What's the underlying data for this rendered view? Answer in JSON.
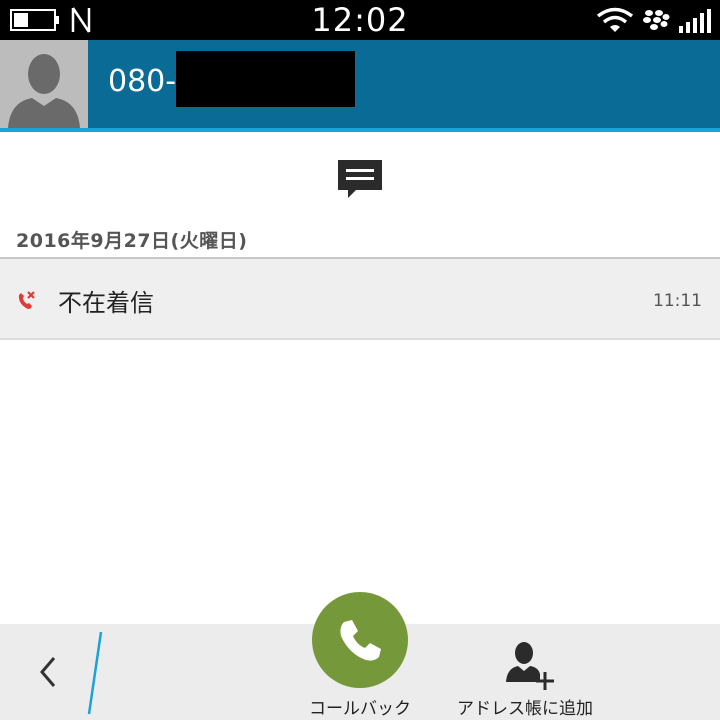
{
  "status_bar": {
    "time": "12:02",
    "icons": [
      "battery-icon",
      "nfc-icon",
      "wifi-icon",
      "blackberry-icon",
      "signal-icon"
    ]
  },
  "header": {
    "phone_number": "080-",
    "avatar_icon": "default-contact-avatar",
    "background_color": "#0a6b96",
    "accent_color": "#1aa2db"
  },
  "main": {
    "message_icon": "message-icon",
    "date": "2016年9月27日(火曜日)",
    "call_log": [
      {
        "icon": "missed-call-icon",
        "label": "不在着信",
        "time": "11:11"
      }
    ]
  },
  "bottom_bar": {
    "back_icon": "back-chevron-icon",
    "callback_label": "コールバック",
    "callback_color": "#75993a",
    "add_contact_label": "アドレス帳に追加"
  }
}
